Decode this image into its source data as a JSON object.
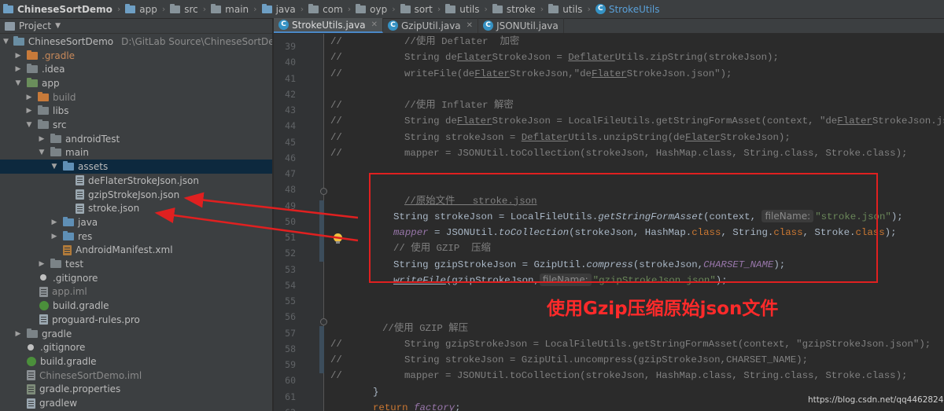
{
  "breadcrumb": [
    "ChineseSortDemo",
    "app",
    "src",
    "main",
    "java",
    "com",
    "oyp",
    "sort",
    "utils",
    "stroke",
    "utils",
    "StrokeUtils"
  ],
  "project_panel": {
    "title": "Project",
    "root_name": "ChineseSortDemo",
    "root_path": "D:\\GitLab Source\\ChineseSortDemo",
    "items": [
      ".gradle",
      ".idea",
      "app",
      "build",
      "libs",
      "src",
      "androidTest",
      "main",
      "assets",
      "deFlaterStrokeJson.json",
      "gzipStrokeJson.json",
      "stroke.json",
      "java",
      "res",
      "AndroidManifest.xml",
      "test",
      ".gitignore",
      "app.iml",
      "build.gradle",
      "proguard-rules.pro",
      "gradle",
      ".gitignore",
      "build.gradle",
      "ChineseSortDemo.iml",
      "gradle.properties",
      "gradlew"
    ]
  },
  "tabs": [
    {
      "label": "StrokeUtils.java",
      "active": true
    },
    {
      "label": "GzipUtil.java",
      "active": false
    },
    {
      "label": "JSONUtil.java",
      "active": false
    }
  ],
  "line_numbers": [
    "39",
    "40",
    "41",
    "42",
    "43",
    "44",
    "45",
    "46",
    "47",
    "48",
    "49",
    "50",
    "51",
    "52",
    "53",
    "54",
    "55",
    "56",
    "57",
    "58",
    "59",
    "60",
    "61",
    "62"
  ],
  "code": {
    "l39": "//使用 Deflater  加密",
    "l40a": "String de",
    "l40b": "Flater",
    "l40c": "StrokeJson = ",
    "l40d": "Deflater",
    "l40e": "Utils.zipString(strokeJson);",
    "l41a": "writeFile(de",
    "l41b": "Flater",
    "l41c": "StrokeJson,\"de",
    "l41d": "Flater",
    "l41e": "StrokeJson.json\");",
    "l43": "//使用 Inflater 解密",
    "l44a": "String de",
    "l44b": "Flater",
    "l44c": "StrokeJson = LocalFileUtils.getStringFormAsset(context, \"de",
    "l44d": "Flater",
    "l44e": "StrokeJson.json\");",
    "l45a": "String strokeJson = ",
    "l45b": "Deflater",
    "l45c": "Utils.unzipString(de",
    "l45d": "Flater",
    "l45e": "StrokeJson);",
    "l46": "mapper = JSONUtil.toCollection(strokeJson, HashMap.class, String.class, Stroke.class);",
    "l49": "//原始文件   stroke.json",
    "l50a": "String strokeJson = LocalFileUtils.",
    "l50b": "getStringFormAsset",
    "l50c": "(context, ",
    "l50hint": "fileName:",
    "l50d": "\"stroke.json\"",
    "l50e": ");",
    "l51a": "mapper",
    "l51b": " = JSONUtil.",
    "l51c": "toCollection",
    "l51d": "(strokeJson, HashMap.",
    "l51e": "class",
    "l51f": ", String.",
    "l51g": "class",
    "l51h": ", Stroke.",
    "l51i": "class",
    "l51j": ");",
    "l52": "// 使用 GZIP  压缩",
    "l53a": "String gzipStrokeJson = GzipUtil.",
    "l53b": "compress",
    "l53c": "(strokeJson,",
    "l53d": "CHARSET_NAME",
    "l53e": ");",
    "l54a": "writeFile",
    "l54b": "(gzipStrokeJson,",
    "l54hint": "fileName:",
    "l54c": "\"gzipStrokeJson.json\"",
    "l54d": ");",
    "l57": "//使用 GZIP 解压",
    "l58": "String gzipStrokeJson = LocalFileUtils.getStringFormAsset(context, \"gzipStrokeJson.json\");",
    "l59": "String strokeJson = GzipUtil.uncompress(gzipStrokeJson,CHARSET_NAME);",
    "l60": "mapper = JSONUtil.toCollection(strokeJson, HashMap.class, String.class, Stroke.class);",
    "l61": "}",
    "l62a": "return ",
    "l62b": "factory",
    "l62c": ";",
    "comment_prefix": "//"
  },
  "annotation": "使用Gzip压缩原始json文件",
  "watermark": "https://blog.csdn.net/qq446282412",
  "colors": {
    "annotation_red": "#ff2a2a",
    "box_red": "#e02020",
    "selection": "#0d293e"
  }
}
